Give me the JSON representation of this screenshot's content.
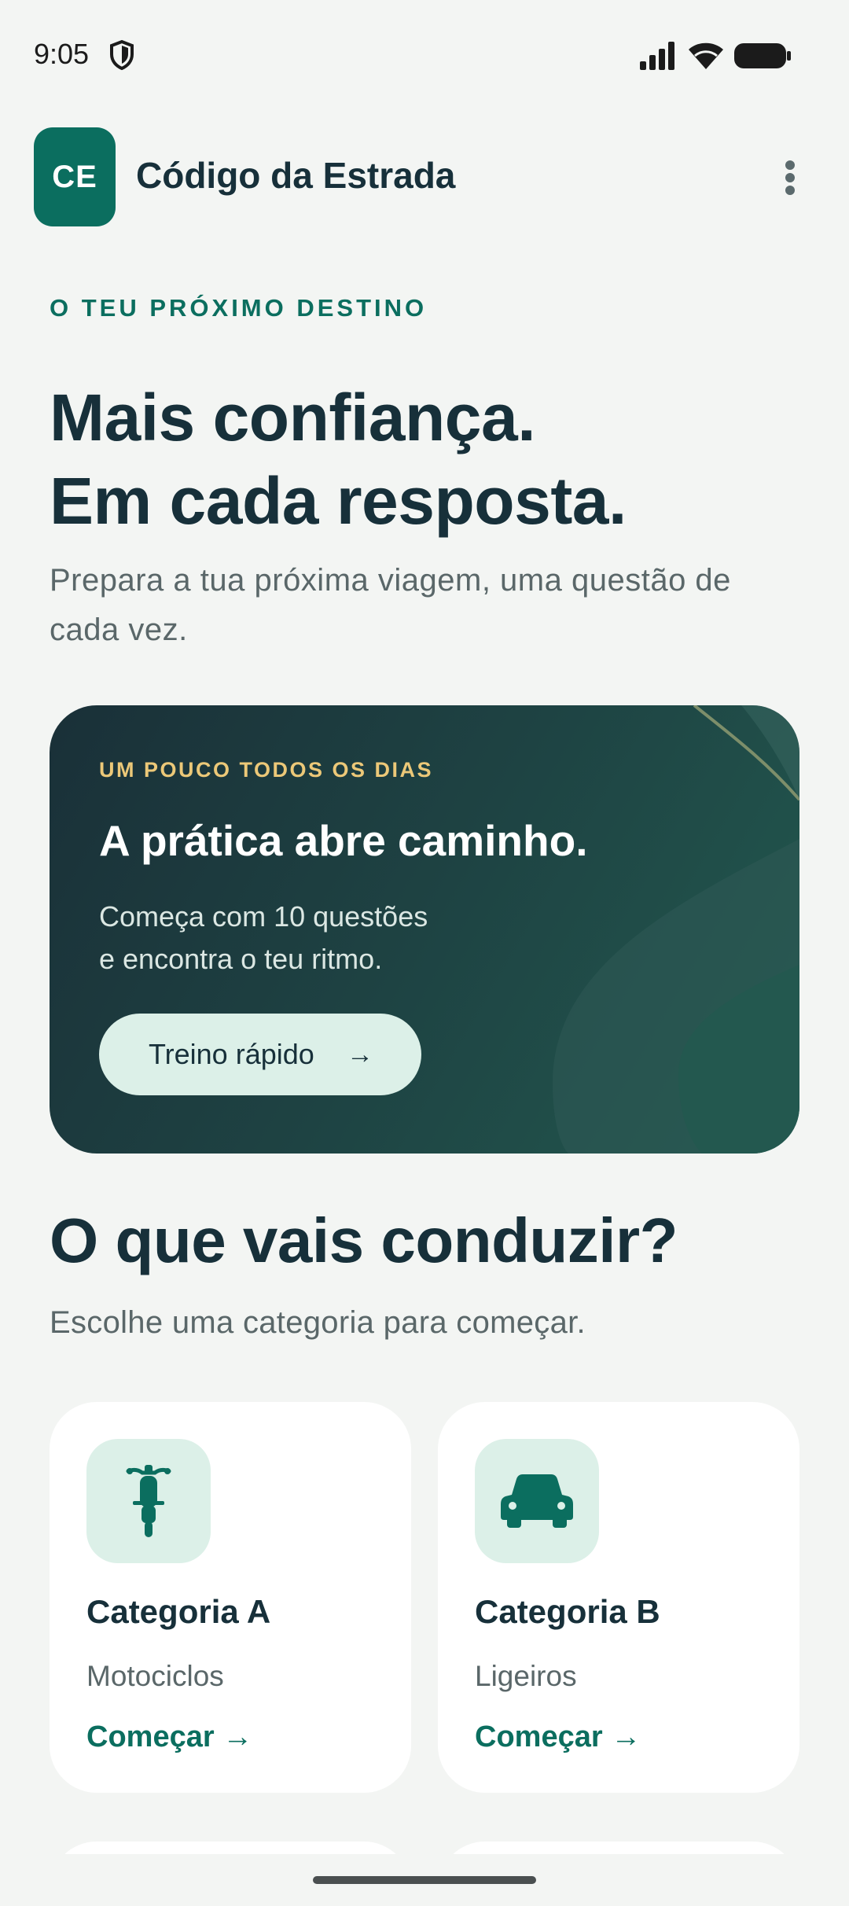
{
  "status_bar": {
    "time": "9:05",
    "icons": [
      "shield-icon",
      "signal-icon",
      "wifi-icon",
      "battery-icon"
    ]
  },
  "app_bar": {
    "logo_text": "CE",
    "title": "Código da Estrada",
    "menu_icon": "more-vert-icon"
  },
  "hero": {
    "eyebrow": "O TEU PRÓXIMO DESTINO",
    "title_line1": "Mais confiança.",
    "title_line2": "Em cada resposta.",
    "subtitle": "Prepara a tua próxima viagem, uma questão de cada vez."
  },
  "promo": {
    "eyebrow": "UM POUCO TODOS OS DIAS",
    "title": "A prática abre caminho.",
    "text_line1": "Começa com 10 questões",
    "text_line2": "e encontra o teu ritmo.",
    "button_label": "Treino rápido",
    "button_arrow": "→"
  },
  "section": {
    "title": "O que vais conduzir?",
    "subtitle": "Escolhe uma categoria para começar."
  },
  "categories": [
    {
      "icon": "motorcycle-icon",
      "title": "Categoria A",
      "subtitle": "Motociclos",
      "cta": "Começar →"
    },
    {
      "icon": "car-icon",
      "title": "Categoria B",
      "subtitle": "Ligeiros",
      "cta": "Começar →"
    }
  ],
  "colors": {
    "background": "#f3f5f3",
    "brand": "#0b6e5f",
    "text_primary": "#17303a",
    "text_secondary": "#5a6769",
    "accent_gold": "#ecc878",
    "mint": "#dcf0e8"
  }
}
